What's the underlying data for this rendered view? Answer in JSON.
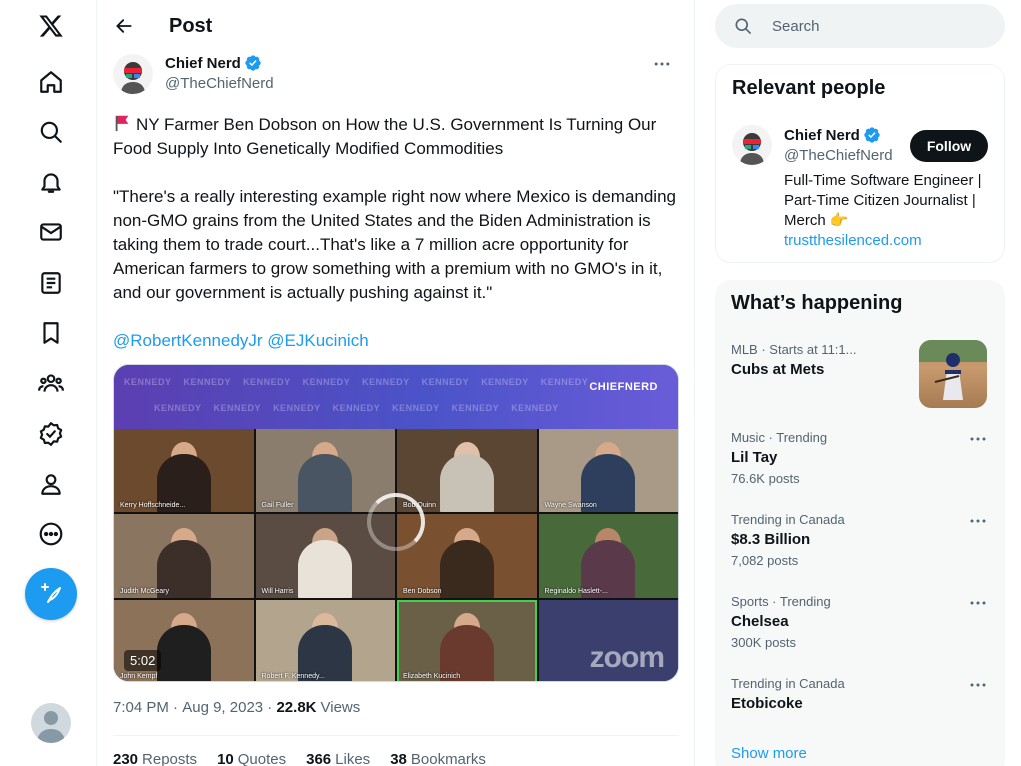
{
  "header": {
    "title": "Post"
  },
  "post": {
    "author_name": "Chief Nerd",
    "author_handle": "@TheChiefNerd",
    "text_line1": "NY Farmer Ben Dobson on How the U.S. Government Is Turning Our Food Supply Into Genetically Modified Commodities",
    "text_quote": "\"There's a really interesting example right now where Mexico is demanding non-GMO grains from the United States and the Biden Administration is taking them to trade court...That's like a 7 million acre opportunity for American farmers to grow something with a premium with no GMO's in it, and our government is actually pushing against it.\"",
    "mention1": "@RobertKennedyJr",
    "mention2": "@EJKucinich",
    "video": {
      "duration": "5:02",
      "watermark": "KENNEDY",
      "brand": "CHIEFNERD",
      "zoom_logo": "zoom",
      "participants": [
        "Kerry Hoffschneide...",
        "Gail Fuller",
        "Bob Quinn",
        "Wayne Swanson",
        "Judith McGeary",
        "Will Harris",
        "Ben Dobson",
        "Reginaldo Haslett-...",
        "John Kempf",
        "Robert F. Kennedy...",
        "Elizabeth Kucinich",
        ""
      ]
    },
    "time": "7:04 PM",
    "date": "Aug 9, 2023",
    "views_count": "22.8K",
    "views_label": "Views",
    "reposts_count": "230",
    "reposts_label": "Reposts",
    "quotes_count": "10",
    "quotes_label": "Quotes",
    "likes_count": "366",
    "likes_label": "Likes",
    "bookmarks_count": "38",
    "bookmarks_label": "Bookmarks"
  },
  "search": {
    "placeholder": "Search"
  },
  "relevant_people": {
    "title": "Relevant people",
    "name": "Chief Nerd",
    "handle": "@TheChiefNerd",
    "follow_label": "Follow",
    "bio": "Full-Time Software Engineer | Part-Time Citizen Journalist | Merch",
    "bio_emoji": "👉",
    "link": "trustthesilenced.com"
  },
  "whats_happening": {
    "title": "What’s happening",
    "trends": [
      {
        "context": "MLB · Starts at 11:1...",
        "title": "Cubs at Mets",
        "posts": ""
      },
      {
        "context": "Music · Trending",
        "title": "Lil Tay",
        "posts": "76.6K posts"
      },
      {
        "context": "Trending in Canada",
        "title": "$8.3 Billion",
        "posts": "7,082 posts"
      },
      {
        "context": "Sports · Trending",
        "title": "Chelsea",
        "posts": "300K posts"
      },
      {
        "context": "Trending in Canada",
        "title": "Etobicoke",
        "posts": ""
      }
    ],
    "show_more": "Show more"
  },
  "colors": {
    "accent": "#1d9bf0",
    "text": "#0f1419",
    "secondary": "#536471",
    "verified": "#1d9bf0"
  },
  "nav_icons": [
    "x-logo-icon",
    "home-icon",
    "explore-icon",
    "notifications-icon",
    "messages-icon",
    "lists-icon",
    "bookmarks-icon",
    "communities-icon",
    "verified-icon",
    "profile-icon",
    "more-icon"
  ]
}
